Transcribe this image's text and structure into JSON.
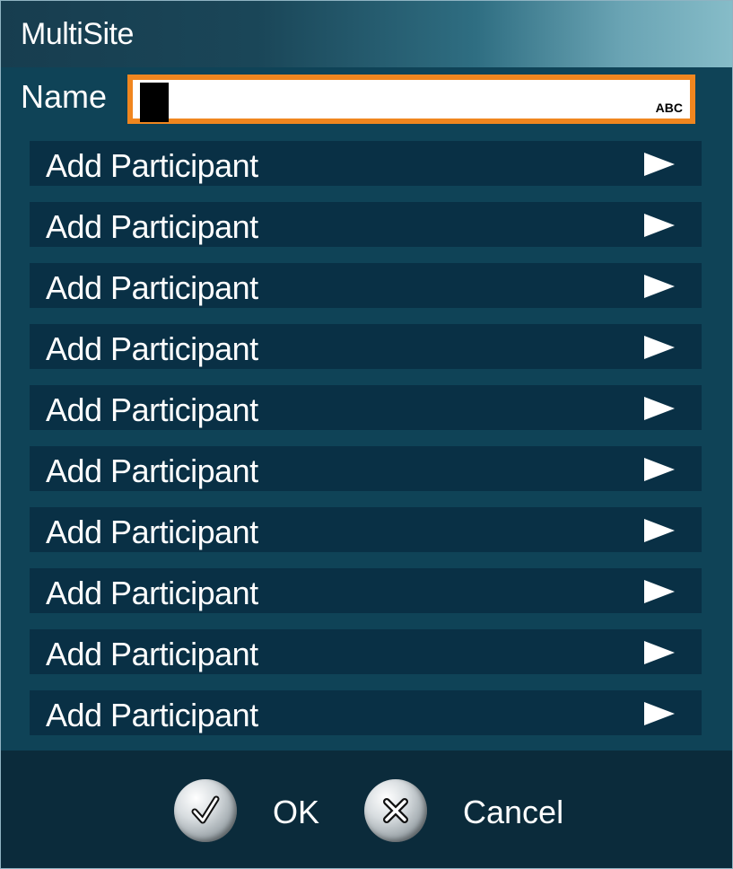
{
  "dialog": {
    "title": "MultiSite"
  },
  "name_field": {
    "label": "Name",
    "value": "",
    "input_mode": "ABC"
  },
  "participants": [
    {
      "label": "Add Participant",
      "icon": "right-arrow-icon"
    },
    {
      "label": "Add Participant",
      "icon": "right-arrow-icon"
    },
    {
      "label": "Add Participant",
      "icon": "right-arrow-icon"
    },
    {
      "label": "Add Participant",
      "icon": "right-arrow-icon"
    },
    {
      "label": "Add Participant",
      "icon": "right-arrow-icon"
    },
    {
      "label": "Add Participant",
      "icon": "right-arrow-icon"
    },
    {
      "label": "Add Participant",
      "icon": "right-arrow-icon"
    },
    {
      "label": "Add Participant",
      "icon": "right-arrow-icon"
    },
    {
      "label": "Add Participant",
      "icon": "right-arrow-icon"
    },
    {
      "label": "Add Participant",
      "icon": "right-arrow-icon"
    }
  ],
  "footer": {
    "ok_label": "OK",
    "ok_icon": "checkmark-icon",
    "cancel_label": "Cancel",
    "cancel_icon": "x-icon"
  },
  "colors": {
    "accent": "#f0861f",
    "panel": "#0f4357",
    "row": "#093045",
    "footer": "#0b2b3b"
  }
}
